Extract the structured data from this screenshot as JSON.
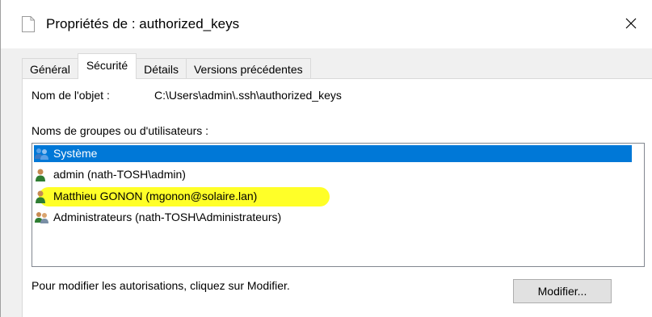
{
  "window": {
    "title": "Propriétés de : authorized_keys",
    "file_icon": "document-icon",
    "close_icon": "close-icon"
  },
  "tabs": [
    {
      "label": "Général",
      "active": false
    },
    {
      "label": "Sécurité",
      "active": true
    },
    {
      "label": "Détails",
      "active": false
    },
    {
      "label": "Versions précédentes",
      "active": false
    }
  ],
  "security": {
    "object_label": "Nom de l'objet :",
    "object_value": "C:\\Users\\admin\\.ssh\\authorized_keys",
    "groups_label": "Noms de groupes ou d'utilisateurs :",
    "principals": [
      {
        "name": "Système",
        "icon": "group-icon",
        "selected": true
      },
      {
        "name": "admin (nath-TOSH\\admin)",
        "icon": "user-icon",
        "selected": false
      },
      {
        "name": "Matthieu GONON (mgonon@solaire.lan)",
        "icon": "user-icon",
        "selected": false,
        "highlighted": true
      },
      {
        "name": "Administrateurs (nath-TOSH\\Administrateurs)",
        "icon": "group-icon",
        "selected": false
      }
    ],
    "hint": "Pour modifier les autorisations, cliquez sur Modifier.",
    "modify_button": "Modifier..."
  },
  "colors": {
    "selection": "#0078d7",
    "highlight": "#ffff28"
  }
}
